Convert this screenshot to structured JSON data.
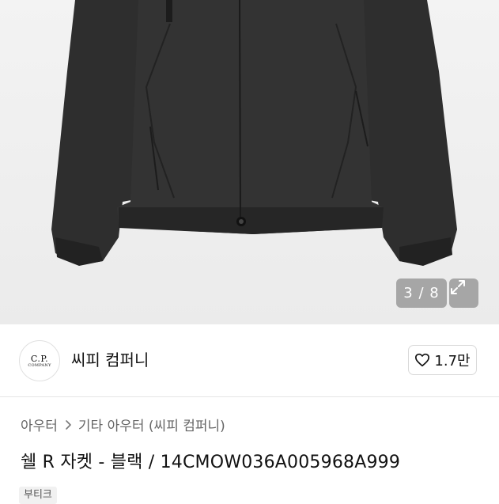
{
  "gallery": {
    "counter": "3 / 8",
    "expand_icon": "expand-arrows-icon"
  },
  "shop": {
    "logo_line1": "C.P.",
    "logo_line2": "COMPANY",
    "name": "씨피 컴퍼니",
    "like_icon": "heart-icon",
    "like_count": "1.7만"
  },
  "breadcrumb": {
    "level1": "아우터",
    "separator_icon": "chevron-right-icon",
    "level2": "기타 아우터 (씨피 컴퍼니)"
  },
  "product": {
    "title": "쉘 R 자켓 - 블랙 / 14CMOW036A005968A999",
    "tag": "부티크"
  }
}
